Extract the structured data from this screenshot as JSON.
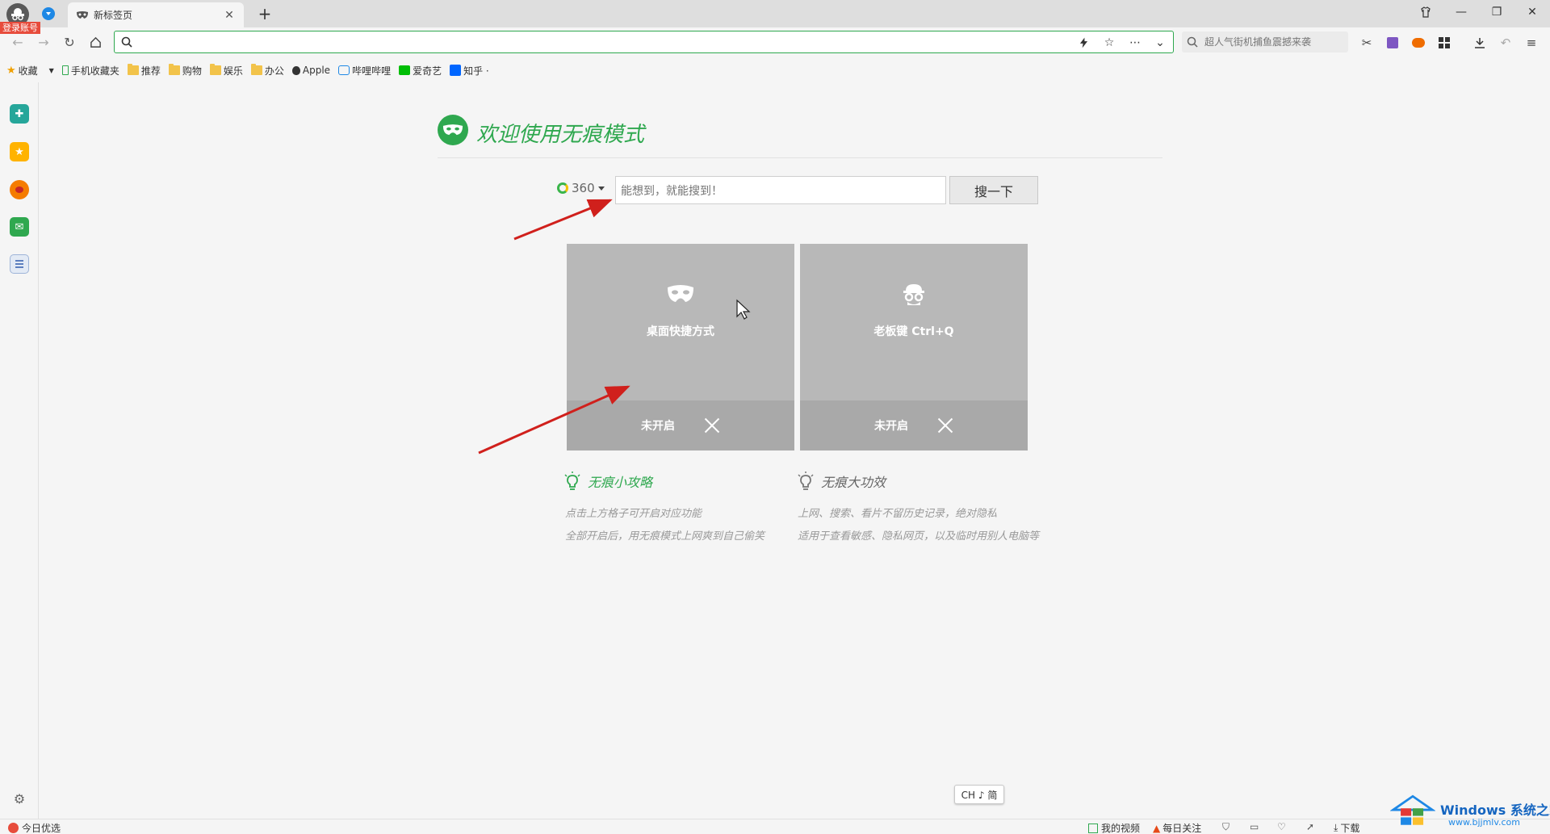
{
  "tab": {
    "title": "新标签页"
  },
  "account": {
    "login_label": "登录账号"
  },
  "address": {
    "value": ""
  },
  "side_search": {
    "placeholder": "超人气街机捕鱼震撼来袭"
  },
  "bookmarks": [
    "收藏",
    "手机收藏夹",
    "推荐",
    "购物",
    "娱乐",
    "办公",
    "Apple",
    "哔哩哔哩",
    "爱奇艺",
    "知乎 ·"
  ],
  "welcome": {
    "title": "欢迎使用无痕模式"
  },
  "search": {
    "engine": "360",
    "placeholder": "能想到，就能搜到！",
    "button": "搜一下"
  },
  "cards": [
    {
      "label": "桌面快捷方式",
      "status": "未开启",
      "icon": "mask-icon"
    },
    {
      "label": "老板键 Ctrl+Q",
      "status": "未开启",
      "icon": "boss-icon"
    }
  ],
  "tips": [
    {
      "title": "无痕小攻略",
      "lines": [
        "点击上方格子可开启对应功能",
        "全部开启后，用无痕模式上网爽到自己偷笑"
      ]
    },
    {
      "title": "无痕大功效",
      "lines": [
        "上网、搜索、看片不留历史记录，绝对隐私",
        "适用于查看敏感、隐私网页，以及临时用别人电脑等"
      ]
    }
  ],
  "ime": {
    "label": "CH ♪ 简"
  },
  "statusbar": {
    "left": "今日优选",
    "video": "我的视频",
    "follow": "每日关注",
    "download": "下载"
  },
  "watermark": {
    "brand": "Windows 系统之家",
    "url": "www.bjjmlv.com"
  },
  "colors": {
    "accent": "#2fa84f",
    "card": "#b8b8b8",
    "card_bottom": "#a9a9a9",
    "arrow": "#d0201c"
  }
}
